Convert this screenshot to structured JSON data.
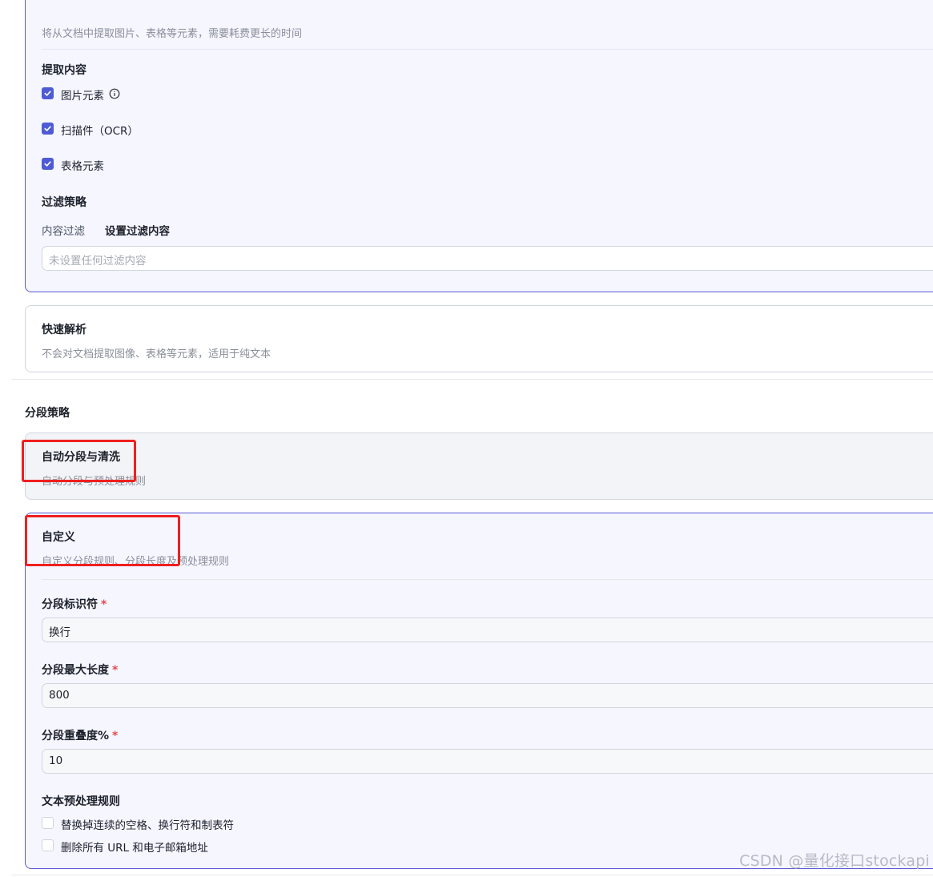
{
  "hq_card": {
    "description": "将从文档中提取图片、表格等元素，需要耗费更长的时间",
    "extract_title": "提取内容",
    "extract_items": [
      {
        "label": "图片元素",
        "checked": true,
        "info": true
      },
      {
        "label": "扫描件（OCR）",
        "checked": true
      },
      {
        "label": "表格元素",
        "checked": true
      }
    ],
    "filter_title": "过滤策略",
    "filter_tab_content": "内容过滤",
    "filter_tab_set": "设置过滤内容",
    "filter_placeholder": "未设置任何过滤内容"
  },
  "fast_card": {
    "title": "快速解析",
    "description": "不会对文档提取图像、表格等元素，适用于纯文本"
  },
  "segment": {
    "section_title": "分段策略",
    "auto": {
      "title": "自动分段与清洗",
      "description": "自动分段与预处理规则"
    },
    "custom": {
      "title": "自定义",
      "description": "自定义分段规则、分段长度及预处理规则",
      "separator_label": "分段标识符",
      "separator_value": "换行",
      "max_length_label": "分段最大长度",
      "max_length_value": "800",
      "overlap_label": "分段重叠度%",
      "overlap_value": "10",
      "required_mark": "*",
      "preprocess_title": "文本预处理规则",
      "rules": [
        {
          "label": "替换掉连续的空格、换行符和制表符",
          "checked": false
        },
        {
          "label": "删除所有 URL 和电子邮箱地址",
          "checked": false
        }
      ]
    }
  },
  "watermark": "CSDN @量化接口stockapi",
  "colors": {
    "accent": "#4f5bd5",
    "highlight_box": "#ef1f1f",
    "required": "#e5484d"
  }
}
